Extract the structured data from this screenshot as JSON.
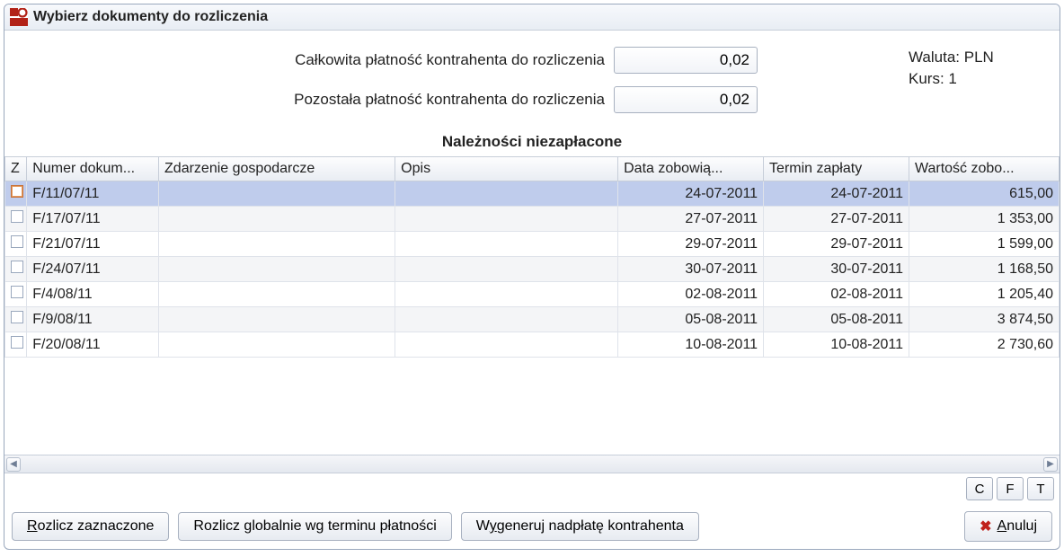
{
  "window": {
    "title": "Wybierz dokumenty do rozliczenia"
  },
  "header": {
    "total_label": "Całkowita płatność kontrahenta do rozliczenia",
    "total_value": "0,02",
    "remaining_label": "Pozostała płatność kontrahenta do rozliczenia",
    "remaining_value": "0,02",
    "currency_label": "Waluta:",
    "currency_value": "PLN",
    "rate_label": "Kurs:",
    "rate_value": "1"
  },
  "section_title": "Należności niezapłacone",
  "columns": {
    "z": "Z",
    "numer": "Numer dokum...",
    "zdarzenie": "Zdarzenie gospodarcze",
    "opis": "Opis",
    "data": "Data zobowią...",
    "termin": "Termin zapłaty",
    "wartosc": "Wartość zobo..."
  },
  "rows": [
    {
      "selected": true,
      "numer": "F/11/07/11",
      "zdarzenie": "",
      "opis": "",
      "data": "24-07-2011",
      "termin": "24-07-2011",
      "wartosc": "615,00"
    },
    {
      "selected": false,
      "numer": "F/17/07/11",
      "zdarzenie": "",
      "opis": "",
      "data": "27-07-2011",
      "termin": "27-07-2011",
      "wartosc": "1 353,00"
    },
    {
      "selected": false,
      "numer": "F/21/07/11",
      "zdarzenie": "",
      "opis": "",
      "data": "29-07-2011",
      "termin": "29-07-2011",
      "wartosc": "1 599,00"
    },
    {
      "selected": false,
      "numer": "F/24/07/11",
      "zdarzenie": "",
      "opis": "",
      "data": "30-07-2011",
      "termin": "30-07-2011",
      "wartosc": "1 168,50"
    },
    {
      "selected": false,
      "numer": "F/4/08/11",
      "zdarzenie": "",
      "opis": "",
      "data": "02-08-2011",
      "termin": "02-08-2011",
      "wartosc": "1 205,40"
    },
    {
      "selected": false,
      "numer": "F/9/08/11",
      "zdarzenie": "",
      "opis": "",
      "data": "05-08-2011",
      "termin": "05-08-2011",
      "wartosc": "3 874,50"
    },
    {
      "selected": false,
      "numer": "F/20/08/11",
      "zdarzenie": "",
      "opis": "",
      "data": "10-08-2011",
      "termin": "10-08-2011",
      "wartosc": "2 730,60"
    }
  ],
  "mini_buttons": {
    "c": "C",
    "f": "F",
    "t": "T"
  },
  "buttons": {
    "rozlicz_zaznaczone": "Rozlicz zaznaczone",
    "rozlicz_globalnie": "Rozlicz globalnie wg terminu płatności",
    "wygeneruj_nadplate": "Wygeneruj nadpłatę kontrahenta",
    "anuluj": "Anuluj"
  }
}
